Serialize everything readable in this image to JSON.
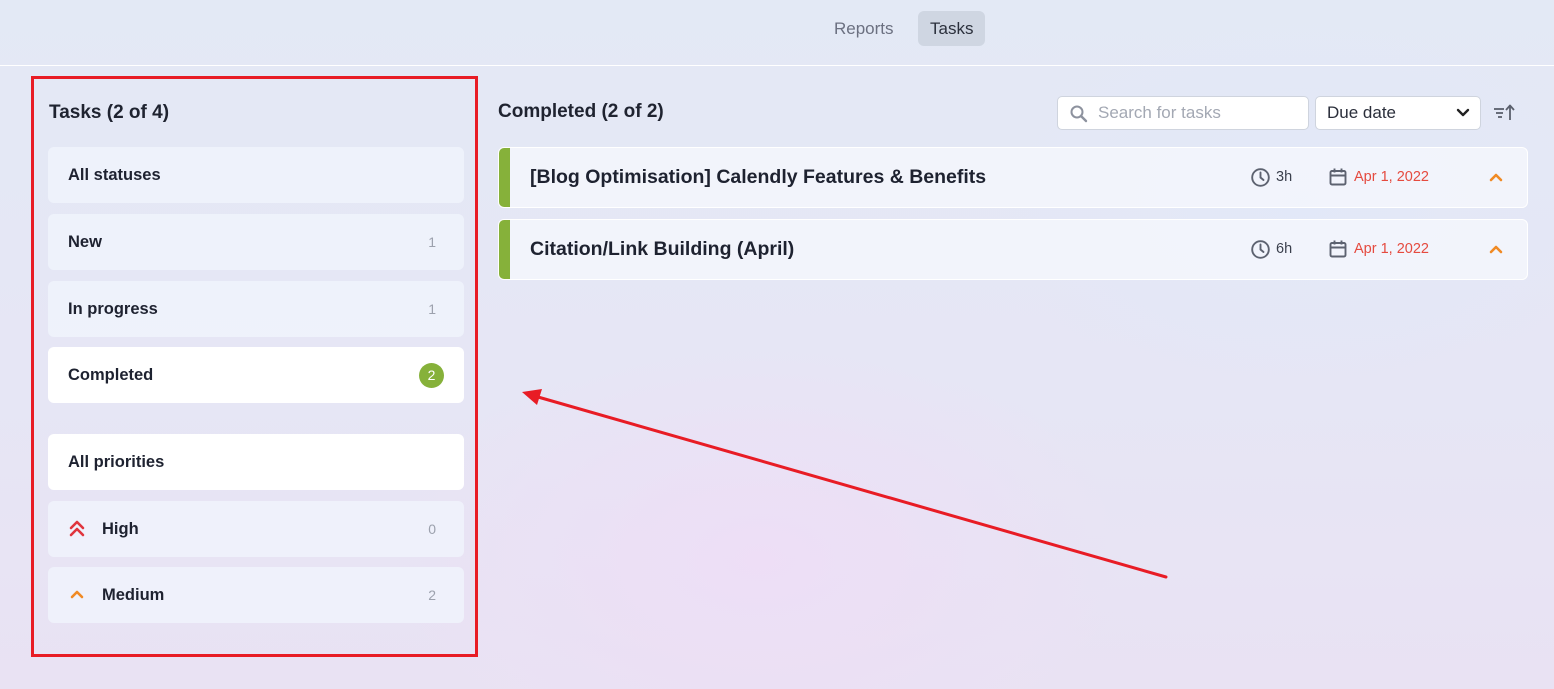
{
  "nav": {
    "tabs": [
      {
        "label": "Reports",
        "active": false
      },
      {
        "label": "Tasks",
        "active": true
      }
    ]
  },
  "left_panel": {
    "title": "Tasks (2 of 4)",
    "statuses": [
      {
        "label": "All statuses",
        "count": ""
      },
      {
        "label": "New",
        "count": "1"
      },
      {
        "label": "In progress",
        "count": "1"
      },
      {
        "label": "Completed",
        "count": "2",
        "active": true
      }
    ],
    "priorities": [
      {
        "label": "All priorities",
        "count": "",
        "active": true
      },
      {
        "label": "High",
        "count": "0",
        "icon": "double-chevron-up-icon"
      },
      {
        "label": "Medium",
        "count": "2",
        "icon": "chevron-up-icon"
      }
    ]
  },
  "main": {
    "title": "Completed (2 of 2)",
    "search": {
      "placeholder": "Search for tasks",
      "value": ""
    },
    "sort": {
      "selected": "Due date"
    },
    "tasks": [
      {
        "title": "[Blog Optimisation] Calendly Features & Benefits",
        "duration": "3h",
        "due_date": "Apr 1, 2022",
        "priority": "medium"
      },
      {
        "title": "Citation/Link Building (April)",
        "duration": "6h",
        "due_date": "Apr 1, 2022",
        "priority": "medium"
      }
    ]
  },
  "colors": {
    "accent_green": "#86b13a",
    "priority_high": "#e0353d",
    "priority_medium": "#f08a24",
    "due_date_red": "#e54a3f",
    "annotation_red": "#e81c25"
  }
}
